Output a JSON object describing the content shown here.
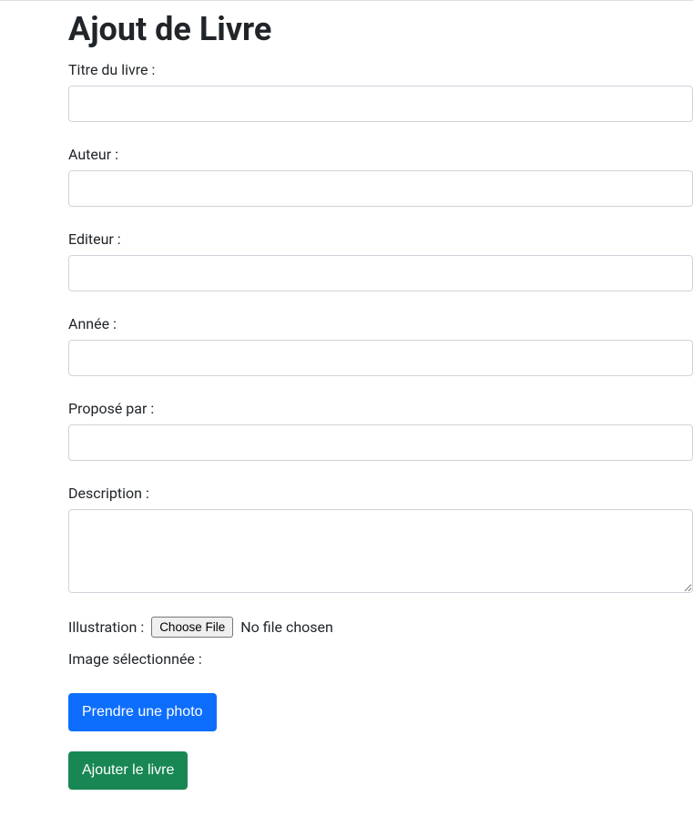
{
  "page": {
    "title": "Ajout de Livre"
  },
  "form": {
    "title": {
      "label": "Titre du livre :",
      "value": ""
    },
    "author": {
      "label": "Auteur :",
      "value": ""
    },
    "publisher": {
      "label": "Editeur :",
      "value": ""
    },
    "year": {
      "label": "Année :",
      "value": ""
    },
    "proposedBy": {
      "label": "Proposé par :",
      "value": ""
    },
    "description": {
      "label": "Description :",
      "value": ""
    },
    "illustration": {
      "label": "Illustration :",
      "chooseFileLabel": "Choose File",
      "noFileText": "No file chosen"
    },
    "selectedImage": {
      "label": "Image sélectionnée :"
    }
  },
  "buttons": {
    "takePhoto": "Prendre une photo",
    "addBook": "Ajouter le livre"
  }
}
